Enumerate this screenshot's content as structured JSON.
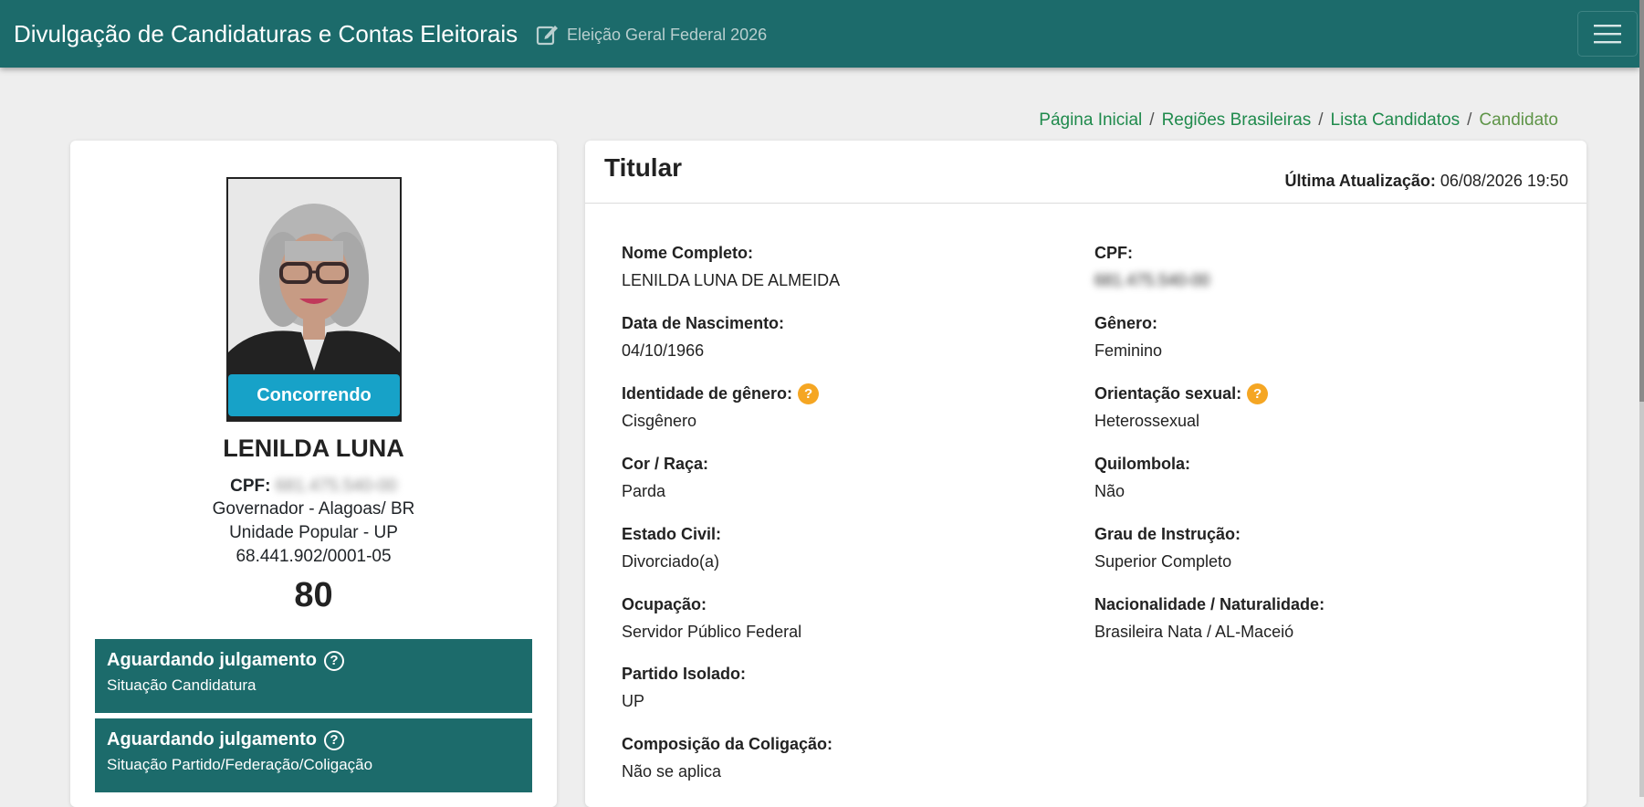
{
  "header": {
    "brand": "Divulgação de Candidaturas e Contas Eleitorais",
    "election": "Eleição Geral Federal 2026",
    "edit_icon": "edit-icon",
    "menu_icon": "hamburger-menu-icon"
  },
  "breadcrumb": {
    "items": [
      "Página Inicial",
      "Regiões Brasileiras",
      "Lista Candidatos"
    ],
    "current": "Candidato",
    "separator": "/"
  },
  "candidate": {
    "photo_icon": "candidate-photo",
    "status": "Concorrendo",
    "name": "LENILDA LUNA",
    "cpf_label": "CPF:",
    "cpf_value": "681.475.540-00",
    "office": "Governador - Alagoas/ BR",
    "party": "Unidade Popular - UP",
    "cnpj": "68.441.902/0001-05",
    "number": "80",
    "situations": [
      {
        "title": "Aguardando julgamento",
        "subtitle": "Situação Candidatura"
      },
      {
        "title": "Aguardando julgamento",
        "subtitle": "Situação Partido/Federação/Coligação"
      }
    ]
  },
  "details": {
    "title": "Titular",
    "last_update_label": "Última Atualização:",
    "last_update_value": "06/08/2026 19:50",
    "left": [
      {
        "label": "Nome Completo:",
        "value": "LENILDA LUNA DE ALMEIDA"
      },
      {
        "label": "Data de Nascimento:",
        "value": "04/10/1966"
      },
      {
        "label": "Identidade de gênero:",
        "value": "Cisgênero"
      },
      {
        "label": "Cor / Raça:",
        "value": "Parda"
      },
      {
        "label": "Estado Civil:",
        "value": "Divorciado(a)"
      },
      {
        "label": "Ocupação:",
        "value": "Servidor Público Federal"
      },
      {
        "label": "Partido Isolado:",
        "value": "UP"
      },
      {
        "label": "Composição da Coligação:",
        "value": "Não se aplica"
      }
    ],
    "right": [
      {
        "label": "CPF:",
        "value": "681.475.540-00"
      },
      {
        "label": "Gênero:",
        "value": "Feminino"
      },
      {
        "label": "Orientação sexual:",
        "value": "Heterossexual"
      },
      {
        "label": "Quilombola:",
        "value": "Não"
      },
      {
        "label": "Grau de Instrução:",
        "value": "Superior Completo"
      },
      {
        "label": "Nacionalidade / Naturalidade:",
        "value": "Brasileira Nata / AL-Maceió"
      }
    ],
    "help_icon": "?"
  },
  "colors": {
    "navbar": "#1c6b6b",
    "badge": "#17a2c8",
    "help": "#f5a623",
    "link": "#1f8a4c"
  }
}
